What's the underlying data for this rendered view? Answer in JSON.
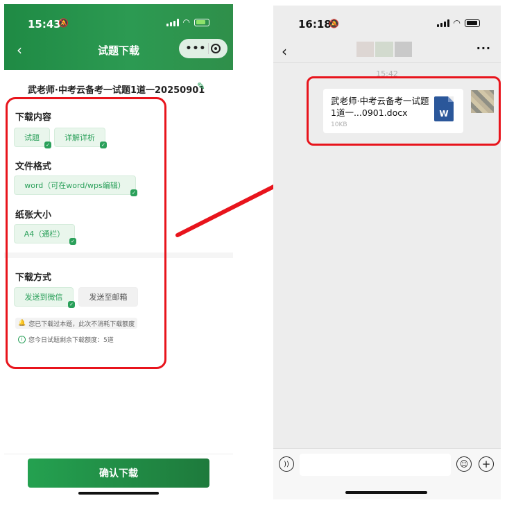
{
  "left": {
    "status_time": "15:43",
    "nav_title": "试题下载",
    "file_title": "武老师·中考云备考一试题1道一20250901",
    "sections": {
      "content_label": "下载内容",
      "content_options": [
        "试题",
        "详解详析"
      ],
      "format_label": "文件格式",
      "format_options": [
        "word（可在word/wps编辑）"
      ],
      "paper_label": "纸张大小",
      "paper_options": [
        "A4（通栏）"
      ],
      "method_label": "下载方式",
      "method_options": [
        "发送到微信",
        "发送至邮箱"
      ]
    },
    "notes": {
      "downloaded": "您已下载过本题，此次不消耗下载额度",
      "quota": "您今日试题剩余下载额度：5道"
    },
    "confirm_button": "确认下载",
    "colors": {
      "brand": "#2aa05a",
      "highlight": "#e8141c"
    }
  },
  "right": {
    "status_time": "16:18",
    "message_time": "15:42",
    "file_name": "武老师·中考云备考一试题1道一...0901.docx",
    "file_size": "10KB",
    "file_icon_letter": "W"
  }
}
